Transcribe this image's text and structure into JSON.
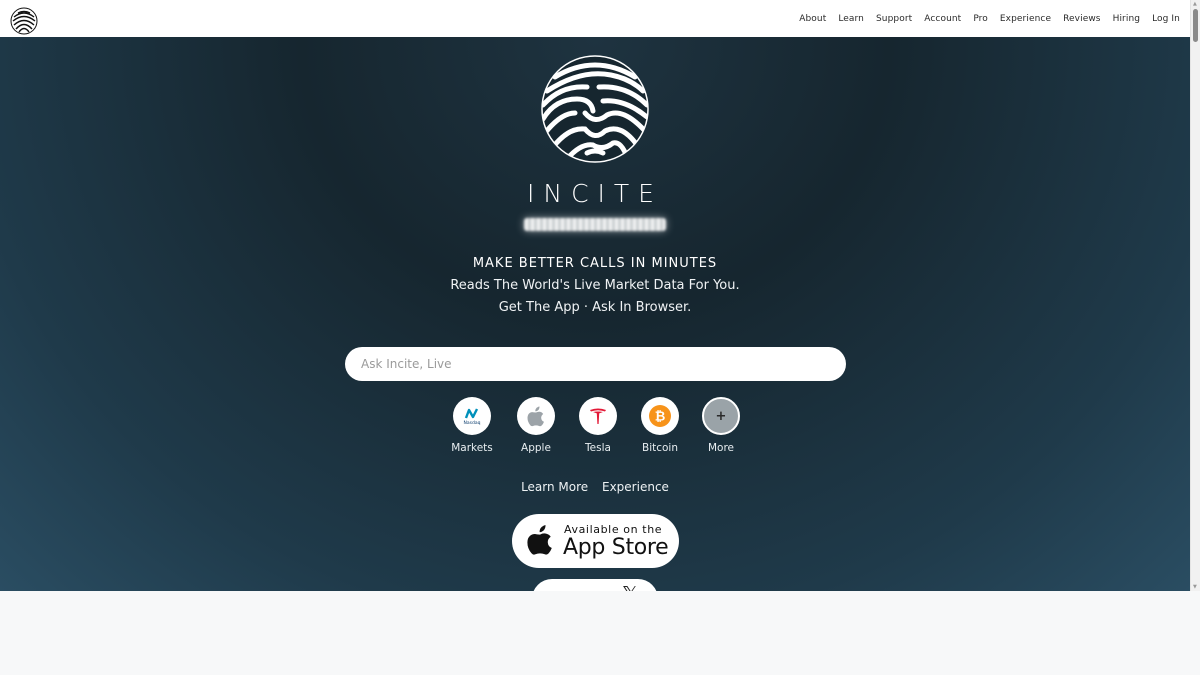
{
  "nav": {
    "items": [
      "About",
      "Learn",
      "Support",
      "Account",
      "Pro",
      "Experience",
      "Reviews",
      "Hiring",
      "Log In"
    ]
  },
  "hero": {
    "brand": "INCITE",
    "headline": "MAKE BETTER CALLS IN MINUTES",
    "subline_1": "Reads The World's Live Market Data For You.",
    "subline_2": "Get The App · Ask In Browser.",
    "search_placeholder": "Ask Incite, Live",
    "quick_links": [
      {
        "label": "Markets",
        "icon": "nasdaq-icon",
        "icon_text": "Nasdaq"
      },
      {
        "label": "Apple",
        "icon": "apple-icon"
      },
      {
        "label": "Tesla",
        "icon": "tesla-icon"
      },
      {
        "label": "Bitcoin",
        "icon": "bitcoin-icon",
        "icon_text": "₿"
      },
      {
        "label": "More",
        "icon": "plus-icon",
        "icon_text": "+"
      }
    ],
    "links": [
      "Learn More",
      "Experience"
    ],
    "appstore": {
      "small": "Available on the",
      "big": "App Store"
    },
    "x_button": {
      "glyph": "𝕏"
    }
  },
  "colors": {
    "hero_top": "#16262f",
    "hero_bottom": "#2a4d62",
    "bitcoin": "#f7931a",
    "tesla": "#e31937",
    "nasdaq": "#0090ba"
  }
}
